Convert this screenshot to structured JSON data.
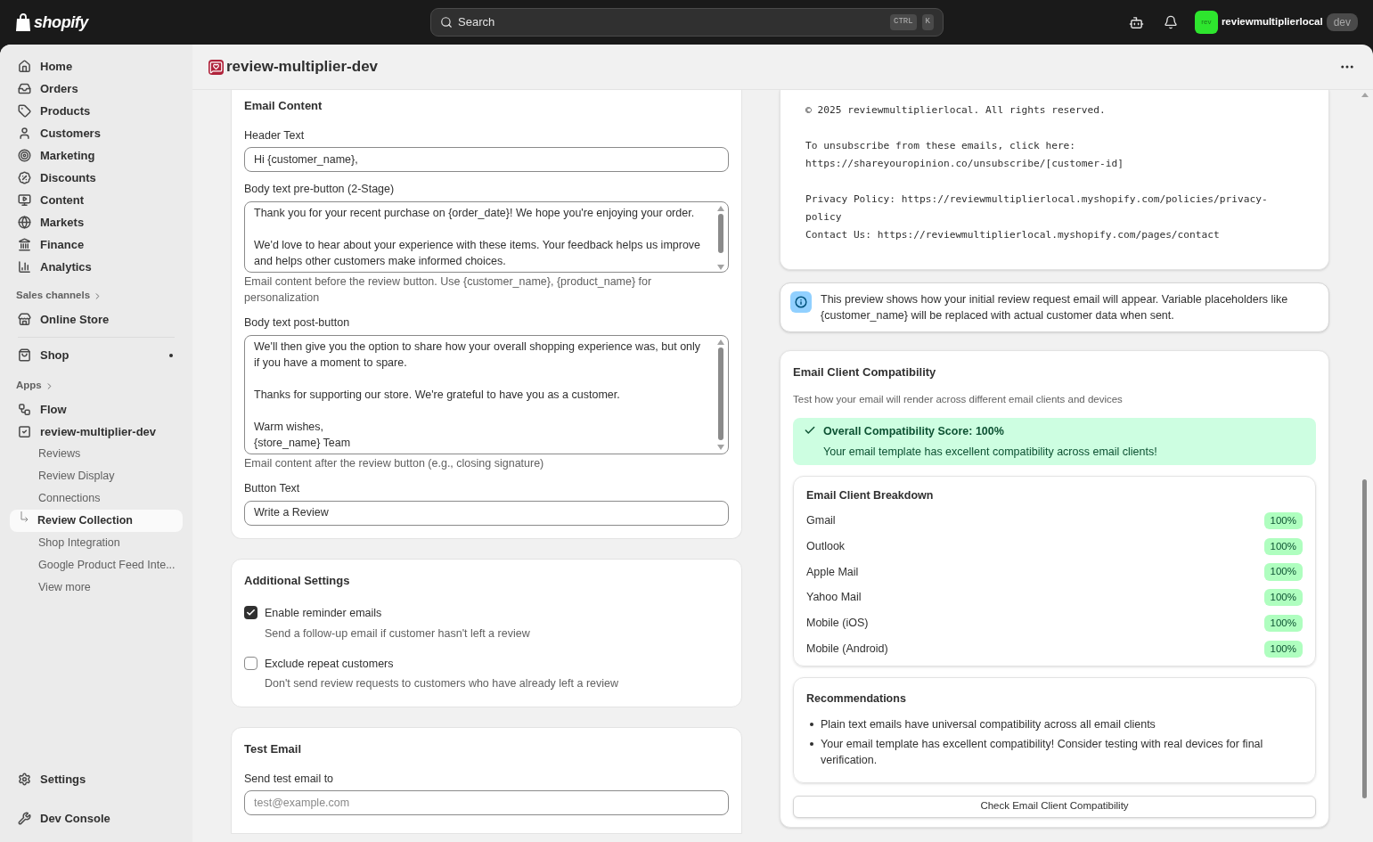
{
  "topbar": {
    "brand": "shopify",
    "search": {
      "placeholder": "Search",
      "keys": [
        "CTRL",
        "K"
      ]
    },
    "store": {
      "avatar": "rev",
      "name": "reviewmultiplierlocal",
      "badge": "dev"
    }
  },
  "sidebar": {
    "items": [
      {
        "label": "Home"
      },
      {
        "label": "Orders"
      },
      {
        "label": "Products"
      },
      {
        "label": "Customers"
      },
      {
        "label": "Marketing"
      },
      {
        "label": "Discounts"
      },
      {
        "label": "Content"
      },
      {
        "label": "Markets"
      },
      {
        "label": "Finance"
      },
      {
        "label": "Analytics"
      }
    ],
    "sales_channels": {
      "heading": "Sales channels",
      "items": [
        {
          "label": "Online Store"
        }
      ]
    },
    "shop": {
      "label": "Shop",
      "dot": true
    },
    "apps": {
      "heading": "Apps",
      "items": [
        {
          "label": "Flow"
        },
        {
          "label": "review-multiplier-dev",
          "children": [
            {
              "label": "Reviews",
              "selected": false
            },
            {
              "label": "Review Display",
              "selected": false
            },
            {
              "label": "Connections",
              "selected": false
            },
            {
              "label": "Review Collection",
              "selected": true
            },
            {
              "label": "Shop Integration",
              "selected": false
            },
            {
              "label": "Google Product Feed Inte...",
              "selected": false
            },
            {
              "label": "View more",
              "selected": false
            }
          ]
        }
      ]
    },
    "footer_items": [
      {
        "label": "Settings"
      },
      {
        "label": "Dev Console"
      }
    ]
  },
  "page": {
    "title": "review-multiplier-dev"
  },
  "email_content": {
    "title": "Email Content",
    "fields": [
      {
        "kind": "input",
        "label": "Header Text",
        "value": "Hi {customer_name},"
      },
      {
        "kind": "textarea",
        "label": "Body text pre-button (2-Stage)",
        "paragraphs": [
          "Thank you for your recent purchase on {order_date}! We hope you're enjoying your order.",
          "We'd love to hear about your experience with these items. Your feedback helps us improve and helps other customers make informed choices."
        ],
        "help": "Email content before the review button. Use {customer_name}, {product_name} for personalization"
      },
      {
        "kind": "textarea",
        "label": "Body text post-button",
        "paragraphs": [
          "We'll then give you the option to share how your overall shopping experience was, but only if you have a moment to spare.",
          "Thanks for supporting our store. We're grateful to have you as a customer.",
          "Warm wishes,\n{store_name} Team"
        ],
        "help": "Email content after the review button (e.g., closing signature)"
      },
      {
        "kind": "input",
        "label": "Button Text",
        "value": "Write a Review"
      }
    ]
  },
  "additional_settings": {
    "title": "Additional Settings",
    "options": [
      {
        "label": "Enable reminder emails",
        "description": "Send a follow-up email if customer hasn't left a review",
        "checked": true
      },
      {
        "label": "Exclude repeat customers",
        "description": "Don't send review requests to customers who have already left a review",
        "checked": false
      }
    ]
  },
  "test_email": {
    "title": "Test Email",
    "label": "Send test email to",
    "placeholder": "test@example.com"
  },
  "preview": {
    "paragraphs": [
      "© 2025 reviewmultiplierlocal. All rights reserved.",
      "To unsubscribe from these emails, click here:\nhttps://shareyouropinion.co/unsubscribe/[customer-id]",
      "Privacy Policy: https://reviewmultiplierlocal.myshopify.com/policies/privacy-policy\nContact Us: https://reviewmultiplierlocal.myshopify.com/pages/contact"
    ]
  },
  "info": "This preview shows how your initial review request email will appear. Variable placeholders like {customer_name} will be replaced with actual customer data when sent.",
  "compatibility": {
    "title": "Email Client Compatibility",
    "subtitle": "Test how your email will render across different email clients and devices",
    "score": {
      "title": "Overall Compatibility Score: 100%",
      "message": "Your email template has excellent compatibility across email clients!"
    },
    "breakdown": {
      "title": "Email Client Breakdown",
      "clients": [
        {
          "name": "Gmail",
          "score": "100%"
        },
        {
          "name": "Outlook",
          "score": "100%"
        },
        {
          "name": "Apple Mail",
          "score": "100%"
        },
        {
          "name": "Yahoo Mail",
          "score": "100%"
        },
        {
          "name": "Mobile (iOS)",
          "score": "100%"
        },
        {
          "name": "Mobile (Android)",
          "score": "100%"
        }
      ]
    },
    "recommendations": {
      "title": "Recommendations",
      "items": [
        "Plain text emails have universal compatibility across all email clients",
        "Your email template has excellent compatibility! Consider testing with real devices for final verification."
      ]
    },
    "button": "Check Email Client Compatibility"
  }
}
